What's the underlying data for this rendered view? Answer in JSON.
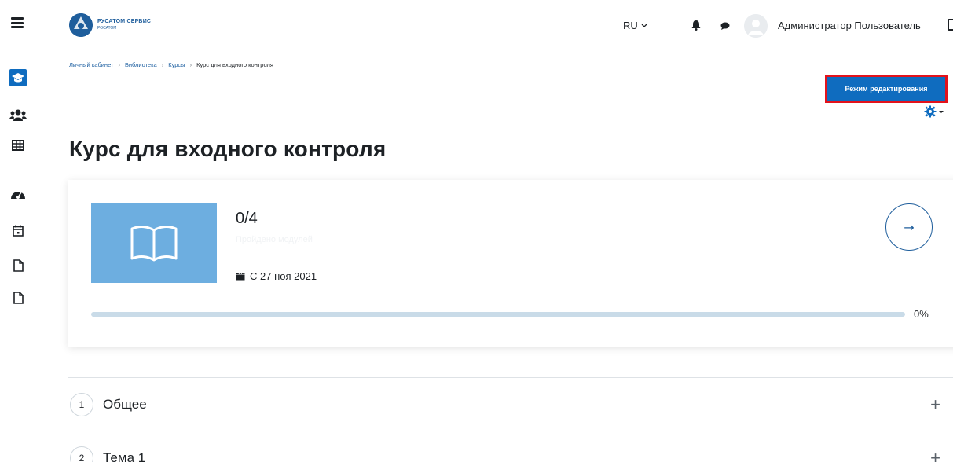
{
  "header": {
    "logo_line1": "РУСАТОМ СЕРВИС",
    "logo_line2": "РОСАТОМ",
    "language": "RU",
    "username": "Администратор Пользователь"
  },
  "breadcrumb": {
    "items": [
      "Личный кабинет",
      "Библиотека",
      "Курсы"
    ],
    "current": "Курс для входного контроля",
    "separator": "›"
  },
  "edit_button": {
    "label": "Режим редактирования"
  },
  "page_title": "Курс для входного контроля",
  "course_card": {
    "progress_count": "0/4",
    "progress_caption": "Пройдено модулей",
    "start_date": "С 27 ноя 2021",
    "progress_percent_label": "0%",
    "progress_fraction": 0
  },
  "sections": [
    {
      "number": "1",
      "title": "Общее"
    },
    {
      "number": "2",
      "title": "Тема 1"
    }
  ],
  "sidebar": {
    "icons": [
      "hamburger-icon",
      "graduation-cap-icon",
      "users-icon",
      "table-icon",
      "dashboard-icon",
      "calendar-icon",
      "file-icon",
      "file-icon"
    ]
  },
  "colors": {
    "accent": "#0f6cbf",
    "brand": "#1f5e9c",
    "course_image_bg": "#6daee0",
    "highlight_border": "#e3121b"
  }
}
